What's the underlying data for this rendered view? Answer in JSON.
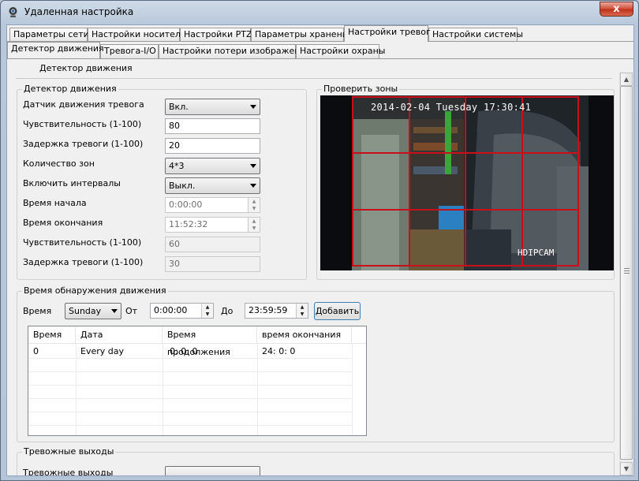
{
  "window": {
    "title": "Удаленная настройка",
    "close_glyph": "x",
    "app_icon": "webcam-icon"
  },
  "tabs_top": [
    "Параметры сети",
    "Настройки носителя",
    "Настройки PTZ",
    "Параметры хранения",
    "Настройки тревог",
    "Настройки системы"
  ],
  "tabs_sub": [
    "Детектор движения",
    "Тревога-I/O",
    "Настройки потери изображения",
    "Настройки охраны"
  ],
  "page_header": "Детектор движения",
  "motion": {
    "group_title": "Детектор движения",
    "labels": [
      "Датчик движения тревога",
      "Чувствительность (1-100)",
      "Задержка тревоги (1-100)",
      "Количество зон",
      "Включить интервалы",
      "Время начала",
      "Время окончания",
      "Чувствительность (1-100)",
      "Задержка тревоги (1-100)"
    ],
    "alarm_value": "Вкл.",
    "sensitivity_value": "80",
    "delay_value": "20",
    "zones_value": "4*3",
    "intervals_value": "Выкл.",
    "start_time": "0:00:00",
    "end_time": "11:52:32",
    "sensitivity2": "60",
    "delay2": "30"
  },
  "preview": {
    "title": "Проверить зоны",
    "osd_timestamp": "2014-02-04 Tuesday 17:30:41",
    "osd_label": "HDIPCAM",
    "grid": {
      "cols": 4,
      "rows": 3,
      "color": "#c8101a"
    }
  },
  "schedule": {
    "group_title": "Время обнаружения движения",
    "time_label": "Время",
    "day_value": "Sunday",
    "from_label": "От",
    "from_value": "0:00:00",
    "to_label": "До",
    "to_value": "23:59:59",
    "add_button": "Добавить",
    "columns": [
      "Время",
      "Дата",
      "Время продолжения",
      "время окончания"
    ],
    "rows": [
      [
        "0",
        "Every day",
        "0: 0: 0",
        "24: 0: 0"
      ]
    ]
  },
  "outputs": {
    "group_title": "Тревожные выходы",
    "label": "Тревожные выходы"
  },
  "scrollbar": {
    "up": "▲",
    "down": "▼"
  },
  "spin": {
    "up": "▲",
    "down": "▼"
  }
}
